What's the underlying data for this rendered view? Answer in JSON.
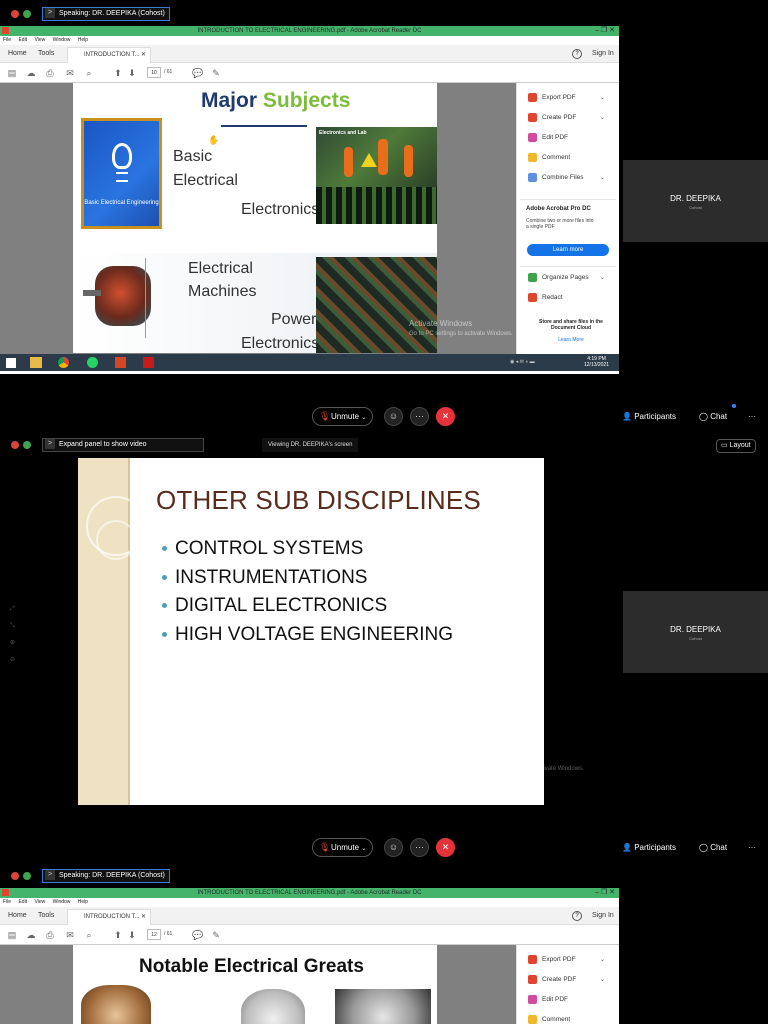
{
  "meeting": {
    "speaking_label": "Speaking: DR. DEEPIKA (Cohost)",
    "expand_label": "Expand panel to show video",
    "viewing_label": "Viewing DR. DEEPIKA's screen",
    "layout_label": "Layout",
    "tile_name": "DR. DEEPIKA",
    "tile_role": "Cohost",
    "unmute_label": "Unmute",
    "participants_label": "Participants",
    "chat_label": "Chat",
    "more_label": "···"
  },
  "acrobat": {
    "window_title": "INTRODUCTION TO ELECTRICAL ENGINEERING.pdf - Adobe Acrobat Reader DC",
    "menu": [
      "File",
      "Edit",
      "View",
      "Window",
      "Help"
    ],
    "home_tab": "Home",
    "tools_tab": "Tools",
    "doc_tab": "INTRODUCTION T...",
    "sign_in": "Sign In",
    "page_total": "/ 61",
    "page_current_top": "10",
    "page_current_bottom": "12",
    "side_tools_top": [
      {
        "label": "Export PDF",
        "color": "#e0452f",
        "chev": "⌄"
      },
      {
        "label": "Create PDF",
        "color": "#e0452f",
        "chev": "⌄"
      },
      {
        "label": "Edit PDF",
        "color": "#d24b9e",
        "chev": ""
      },
      {
        "label": "Comment",
        "color": "#f1b72a",
        "chev": ""
      },
      {
        "label": "Combine Files",
        "color": "#5e8fe0",
        "chev": "⌄"
      }
    ],
    "promo_title": "Adobe Acrobat Pro DC",
    "promo_text": "Combine two or more files into a single PDF",
    "learn_more": "Learn more",
    "side_tools_bottom": [
      {
        "label": "Organize Pages",
        "color": "#3fa34d",
        "chev": "⌄"
      },
      {
        "label": "Redact",
        "color": "#e0452f",
        "chev": ""
      }
    ],
    "store_text": "Store and share files in the Document Cloud",
    "store_link": "Learn More",
    "side_tools_p3": [
      {
        "label": "Export PDF",
        "color": "#e0452f",
        "chev": "⌄"
      },
      {
        "label": "Create PDF",
        "color": "#e0452f",
        "chev": "⌄"
      },
      {
        "label": "Edit PDF",
        "color": "#d24b9e",
        "chev": ""
      },
      {
        "label": "Comment",
        "color": "#f1b72a",
        "chev": ""
      }
    ]
  },
  "slide1": {
    "title_a": "Major",
    "title_b": "Subjects",
    "basic": "Basic",
    "electrical": "Electrical",
    "electronics": "Electronics",
    "tile_label": "Basic Electrical Engineering",
    "photo_label": "Electronics and Lab",
    "electrical2": "Electrical",
    "machines": "Machines",
    "power": "Power",
    "electronics2": "Electronics"
  },
  "activate": {
    "line1": "Activate Windows",
    "line2": "Go to PC settings to activate Windows."
  },
  "taskbar": {
    "time": "4:19 PM",
    "date": "12/13/2021"
  },
  "slide2": {
    "title": "OTHER SUB DISCIPLINES",
    "bullets": [
      "CONTROL SYSTEMS",
      "INSTRUMENTATIONS",
      "DIGITAL ELECTRONICS",
      "HIGH VOLTAGE ENGINEERING"
    ]
  },
  "slide3": {
    "title": "Notable Electrical Greats"
  }
}
